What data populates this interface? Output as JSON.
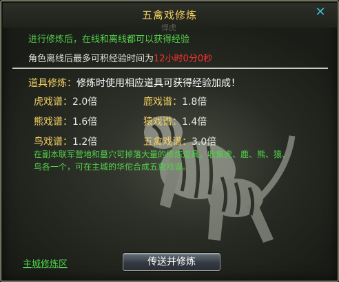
{
  "window": {
    "title": "五禽戏修炼",
    "close_symbol": "✕",
    "ghost_text": "悍虎"
  },
  "intro": {
    "line1": "进行修炼后，在线和离线都可以获得经验",
    "offline_prefix": "角色离线后最多可积经验时间为",
    "offline_time": "12小时0分0秒"
  },
  "items": {
    "label": "道具修炼：",
    "description": "修炼时使用相应道具可获得经验加成！",
    "scrolls": [
      {
        "name": "虎戏谱：",
        "value": "2.0倍"
      },
      {
        "name": "鹿戏谱：",
        "value": "1.8倍"
      },
      {
        "name": "熊戏谱：",
        "value": "1.6倍"
      },
      {
        "name": "猿戏谱：",
        "value": "1.4倍"
      },
      {
        "name": "鸟戏谱：",
        "value": "1.2倍"
      },
      {
        "name": "五禽戏谱：",
        "value": "3.0倍"
      }
    ],
    "notes_line1": "在副本联军营地和墓穴可掉落大量的修炼道具。收集虎、鹿、熊、猿、",
    "notes_line2": "鸟各一个，可在主城的华佗合成五禽戏谱。"
  },
  "footer": {
    "map_link": "主城修炼区",
    "action_button": "传送并修炼"
  },
  "colors": {
    "title_gold": "#f2cf63",
    "green_text": "#52d24a",
    "red_time": "#ff3030",
    "close_blue": "#3fb7d9"
  }
}
